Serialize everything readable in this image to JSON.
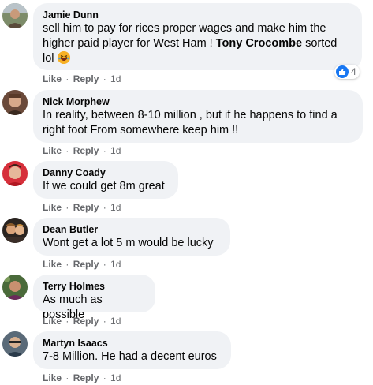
{
  "comments": [
    {
      "author": "Jamie Dunn",
      "text_lines": [
        "sell him to pay for rices proper wages and make him the",
        "higher paid player for West Ham ! "
      ],
      "mention": "Tony Crocombe",
      "mention_suffix": " sorted",
      "text_line3": "lol",
      "emoji": "laughing-emoji",
      "reaction_count": "4",
      "like": "Like",
      "reply": "Reply",
      "time": "1d"
    },
    {
      "author": "Nick Morphew",
      "text_lines": [
        "In reality, between 8-10 million , but if he happens to find a",
        "right foot From somewhere keep him !!"
      ],
      "like": "Like",
      "reply": "Reply",
      "time": "1d"
    },
    {
      "author": "Danny Coady",
      "text_lines": [
        "If we could get 8m great"
      ],
      "like": "Like",
      "reply": "Reply",
      "time": "1d"
    },
    {
      "author": "Dean Butler",
      "text_lines": [
        "Wont get a lot 5 m would be lucky"
      ],
      "like": "Like",
      "reply": "Reply",
      "time": "1d"
    },
    {
      "author": "Terry Holmes",
      "text_lines": [
        "As much as possible"
      ],
      "like": "Like",
      "reply": "Reply",
      "time": "1d"
    },
    {
      "author": "Martyn Isaacs",
      "text_lines": [
        "7-8 Million. He had a decent euros"
      ],
      "like": "Like",
      "reply": "Reply",
      "time": "1d"
    }
  ],
  "colors": {
    "bubble_bg": "#f0f2f5",
    "meta_text": "#65676b",
    "like_blue": "#1877f2"
  }
}
